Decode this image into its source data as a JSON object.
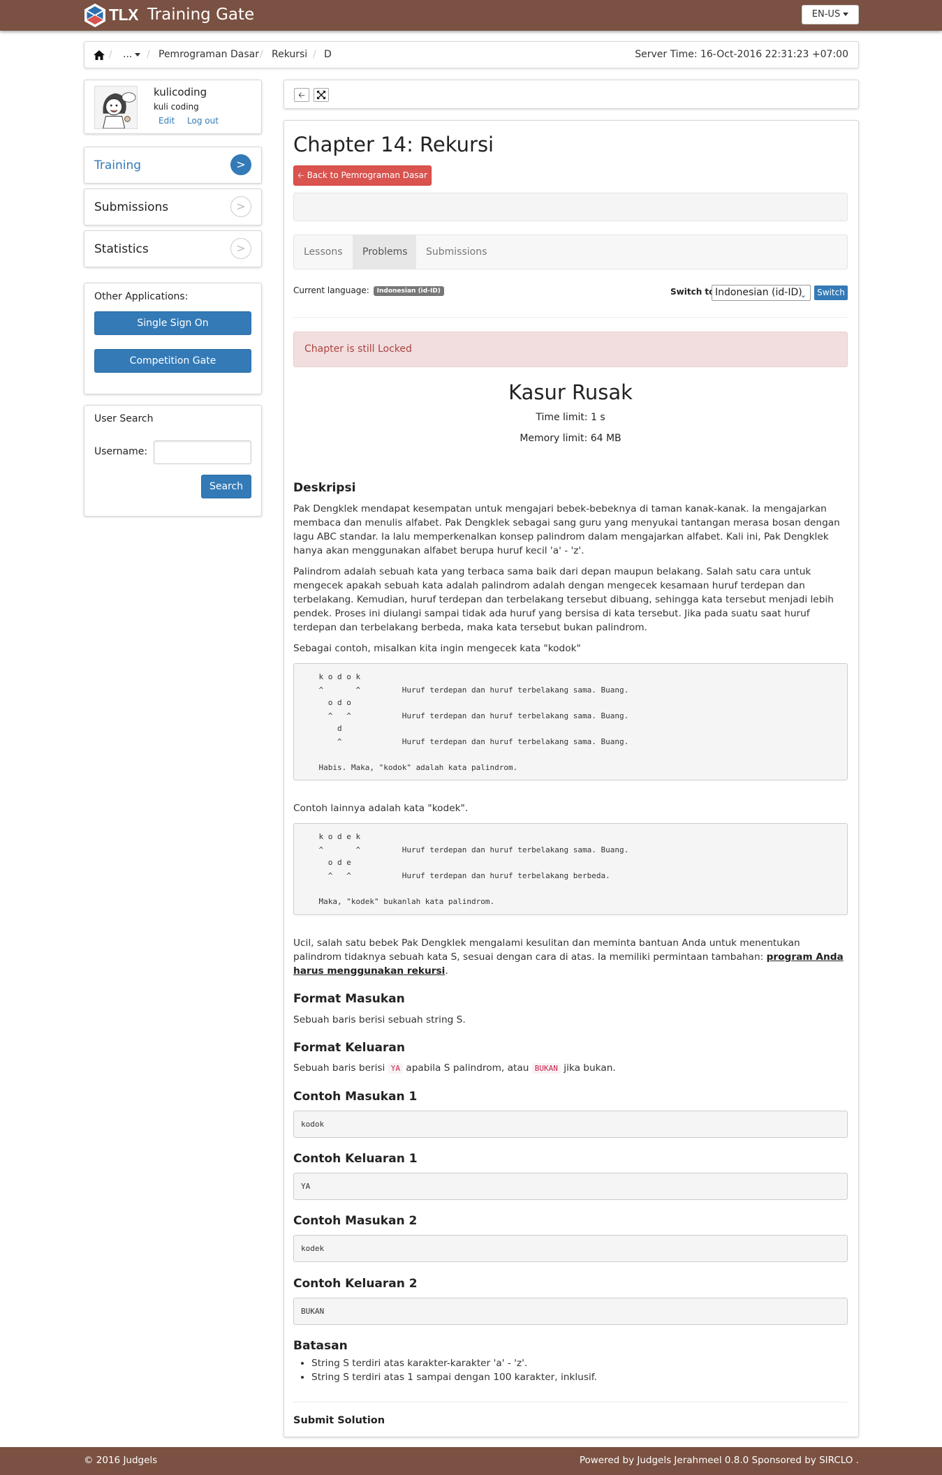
{
  "header": {
    "brand_logo": "TLX",
    "app_title": "Training Gate",
    "language_button": "EN-US"
  },
  "breadcrumb": {
    "home_icon": "home-icon",
    "items": [
      "...",
      "Pemrograman Dasar",
      "Rekursi",
      "D"
    ],
    "server_time": "Server Time: 16-Oct-2016 22:31:23 +07:00"
  },
  "user": {
    "username": "kulicoding",
    "fullname": "kuli coding",
    "edit_label": "Edit",
    "logout_label": "Log out"
  },
  "nav": {
    "items": [
      {
        "label": "Training",
        "arrow": ">"
      },
      {
        "label": "Submissions",
        "arrow": ">"
      },
      {
        "label": "Statistics",
        "arrow": ">"
      }
    ]
  },
  "other_apps": {
    "title": "Other Applications:",
    "buttons": [
      "Single Sign On",
      "Competition Gate"
    ]
  },
  "user_search": {
    "title": "User Search",
    "username_label": "Username:",
    "username_value": "",
    "search_button": "Search"
  },
  "chapter": {
    "title": "Chapter 14: Rekursi",
    "back_button": "Back to Pemrograman Dasar",
    "tabs": [
      "Lessons",
      "Problems",
      "Submissions"
    ]
  },
  "language": {
    "current_label": "Current language:",
    "current_value": "Indonesian (id-ID)",
    "switch_label": "Switch to",
    "selected": "Indonesian (id-ID)",
    "switch_button": "Switch"
  },
  "alert": "Chapter is still Locked",
  "problem": {
    "title": "Kasur Rusak",
    "time_limit": "Time limit: 1 s",
    "memory_limit": "Memory limit: 64 MB",
    "deskripsi_heading": "Deskripsi",
    "p1": "Pak Dengklek mendapat kesempatan untuk mengajari bebek-bebeknya di taman kanak-kanak. Ia mengajarkan membaca dan menulis alfabet. Pak Dengklek sebagai sang guru yang menyukai tantangan merasa bosan dengan lagu ABC standar. Ia lalu memperkenalkan konsep palindrom dalam mengajarkan alfabet. Kali ini, Pak Dengklek hanya akan menggunakan alfabet berupa huruf kecil 'a' - 'z'.",
    "p2": "Palindrom adalah sebuah kata yang terbaca sama baik dari depan maupun belakang. Salah satu cara untuk mengecek apakah sebuah kata adalah palindrom adalah dengan mengecek kesamaan huruf terdepan dan terbelakang. Kemudian, huruf terdepan dan terbelakang tersebut dibuang, sehingga kata tersebut menjadi lebih pendek. Proses ini diulangi sampai tidak ada huruf yang bersisa di kata tersebut. Jika pada suatu saat huruf terdepan dan terbelakang berbeda, maka kata tersebut bukan palindrom.",
    "p3": "Sebagai contoh, misalkan kita ingin mengecek kata \"kodok\"",
    "code1": "    k o d o k\n    ^       ^         Huruf terdepan dan huruf terbelakang sama. Buang.\n      o d o\n      ^   ^           Huruf terdepan dan huruf terbelakang sama. Buang.\n        d\n        ^             Huruf terdepan dan huruf terbelakang sama. Buang.\n\n    Habis. Maka, \"kodok\" adalah kata palindrom.",
    "p4": "Contoh lainnya adalah kata \"kodek\".",
    "code2": "    k o d e k\n    ^       ^         Huruf terdepan dan huruf terbelakang sama. Buang.\n      o d e\n      ^   ^           Huruf terdepan dan huruf terbelakang berbeda.\n\n    Maka, \"kodek\" bukanlah kata palindrom.",
    "p5_before": "Ucil, salah satu bebek Pak Dengklek mengalami kesulitan dan meminta bantuan Anda untuk menentukan palindrom tidaknya sebuah kata S, sesuai dengan cara di atas. Ia memiliki permintaan tambahan: ",
    "p5_link": "program Anda harus menggunakan rekursi",
    "p5_after": ".",
    "format_masukan_heading": "Format Masukan",
    "format_masukan": "Sebuah baris berisi sebuah string S.",
    "format_keluaran_heading": "Format Keluaran",
    "fk_before": "Sebuah baris berisi ",
    "fk_code1": "YA",
    "fk_mid": " apabila S palindrom, atau ",
    "fk_code2": "BUKAN",
    "fk_after": " jika bukan.",
    "samples": [
      {
        "heading": "Contoh Masukan 1",
        "value": "kodok"
      },
      {
        "heading": "Contoh Keluaran 1",
        "value": "YA"
      },
      {
        "heading": "Contoh Masukan 2",
        "value": "kodek"
      },
      {
        "heading": "Contoh Keluaran 2",
        "value": "BUKAN"
      }
    ],
    "batasan_heading": "Batasan",
    "batasan": [
      "String S terdiri atas karakter-karakter 'a' - 'z'.",
      "String S terdiri atas 1 sampai dengan 100 karakter, inklusif."
    ],
    "submit_heading": "Submit Solution"
  },
  "footer": {
    "left": "© 2016 Judgels",
    "right": "Powered by Judgels Jerahmeel 0.8.0 Sponsored by SIRCLO ."
  },
  "colors": {
    "header_brown": "#7a5142",
    "primary_blue": "#337ab7",
    "danger_red": "#d9534f",
    "alert_bg": "#f2dede",
    "alert_text": "#a94442"
  }
}
